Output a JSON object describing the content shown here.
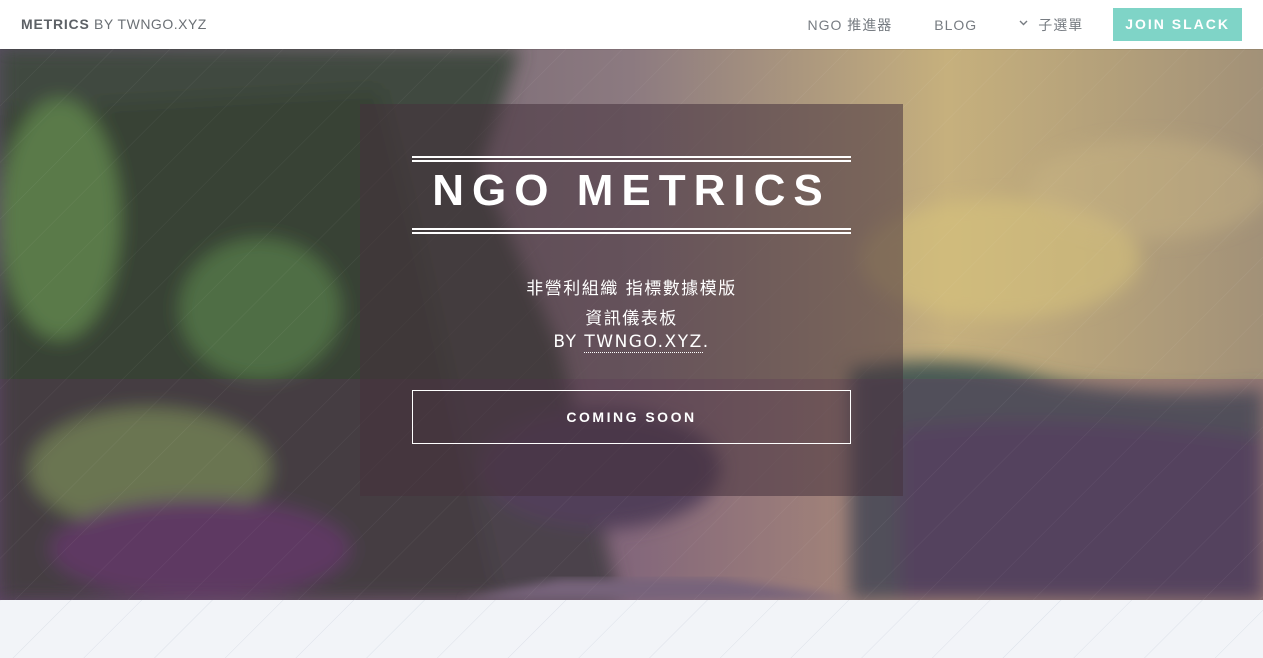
{
  "header": {
    "brand_bold": "METRICS",
    "brand_rest": "BY TWNGO.XYZ",
    "nav": {
      "ngo_link": "NGO 推進器",
      "blog_link": "BLOG",
      "submenu_link": "子選單",
      "join_slack": "JOIN SLACK"
    }
  },
  "hero": {
    "title": "NGO METRICS",
    "subtitle_line1": "非營利組織 指標數據模版",
    "subtitle_line2": "資訊儀表板",
    "subtitle_by": "BY",
    "subtitle_link": "TWNGO.XYZ",
    "subtitle_end": ".",
    "cta_label": "COMING SOON"
  },
  "colors": {
    "accent": "#7fd4c7",
    "header_bg": "#ffffff",
    "panel_bg": "rgba(70,50,60,0.55)",
    "below_bg": "#f2f4f8"
  }
}
